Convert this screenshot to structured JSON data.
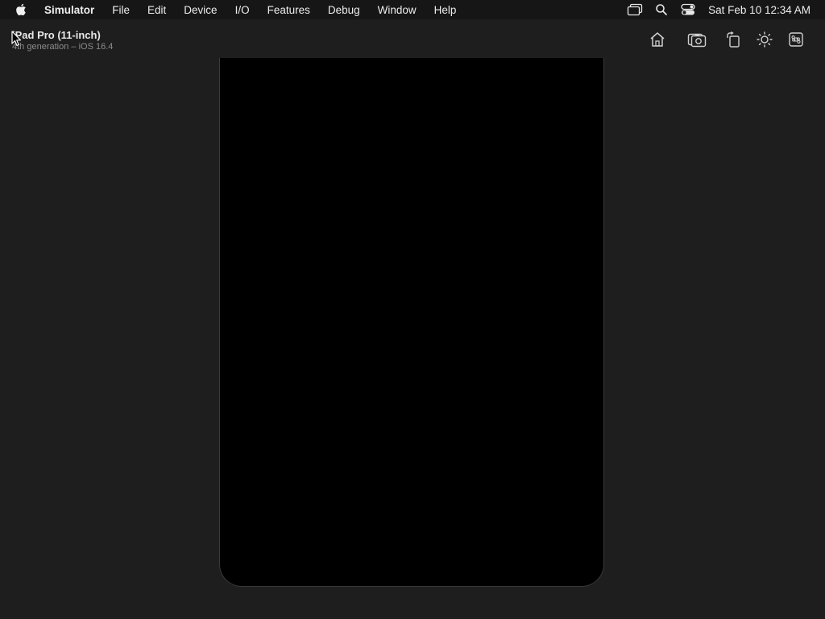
{
  "menubar": {
    "apple_icon": "apple-logo-icon",
    "app_name": "Simulator",
    "items": [
      "File",
      "Edit",
      "Device",
      "I/O",
      "Features",
      "Debug",
      "Window",
      "Help"
    ],
    "status_icons": [
      "screen-mirroring-icon",
      "spotlight-search-icon",
      "control-center-icon"
    ],
    "clock": "Sat Feb 10  12:34 AM"
  },
  "titlebar": {
    "device_name": "iPad Pro (11-inch)",
    "device_subtitle": "4th generation – iOS 16.4",
    "toolbar_icons": [
      "home-icon",
      "screenshot-icon",
      "rotate-icon",
      "appearance-icon",
      "keyboard-command-icon"
    ]
  },
  "device": {
    "screen_state": "black"
  }
}
